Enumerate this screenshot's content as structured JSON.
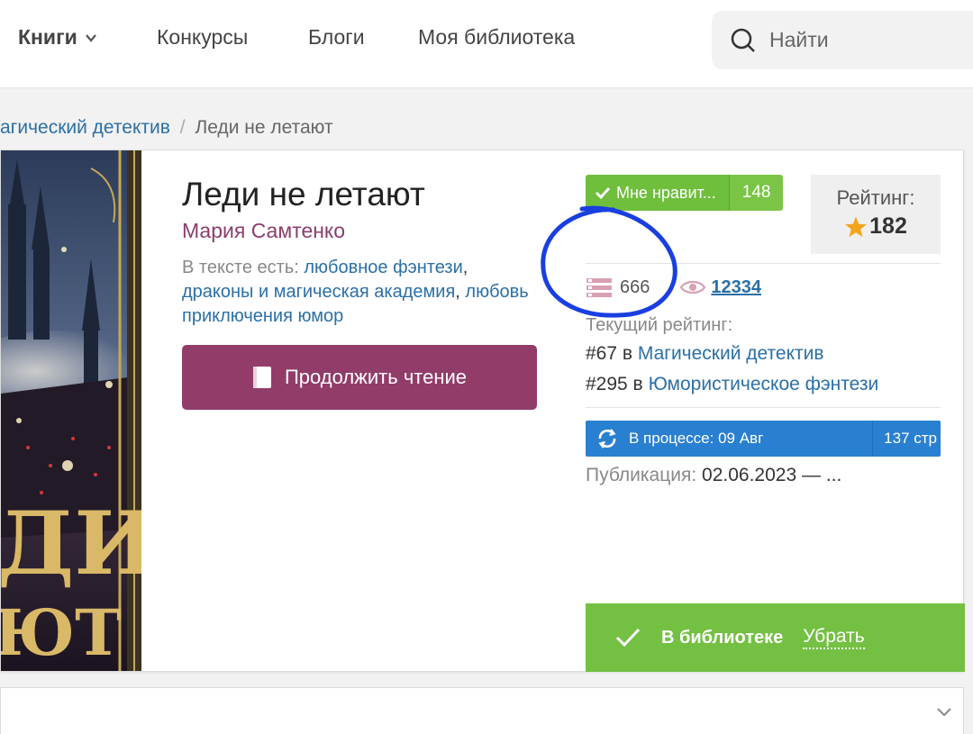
{
  "nav": {
    "items": [
      {
        "label": "Книги",
        "has_dropdown": true
      },
      {
        "label": "Конкурсы"
      },
      {
        "label": "Блоги"
      },
      {
        "label": "Моя библиотека"
      }
    ],
    "search": {
      "placeholder": "Найти"
    }
  },
  "breadcrumb": {
    "parent": "агический детектив",
    "separator": "/",
    "current": "Леди не летают"
  },
  "book": {
    "title": "Леди не летают",
    "author": "Мария Самтенко",
    "tags_label": "В тексте есть:",
    "tags": [
      "любовное фэнтези",
      "драконы и магическая академия",
      "любовь приключения юмор"
    ],
    "read_button": "Продолжить чтение"
  },
  "stats": {
    "like_label": "Мне нравит...",
    "like_count": "148",
    "rating_label": "Рейтинг:",
    "rating_value": "182",
    "library_count": "666",
    "views": "12334",
    "current_rating_label": "Текущий рейтинг:",
    "rank1_prefix": "#67 в",
    "rank1_genre": "Магический детектив",
    "rank2_prefix": "#295 в",
    "rank2_genre": "Юмористическое фэнтези",
    "status": "В процессе: 09 Авг",
    "pages": "137 стр",
    "publication_label": "Публикация:",
    "publication_date": "02.06.2023 — ...",
    "library_label": "В библиотеке",
    "remove_label": "Убрать"
  },
  "cover": {
    "visible_text_line1": "ДИ",
    "visible_text_line2": "ЮТ"
  },
  "colors": {
    "accent_purple": "#923c69",
    "link_blue": "#2b6fa6",
    "like_green": "#6fbe3c",
    "status_blue": "#2a80d0",
    "library_green": "#74c043",
    "annotation_blue": "#1a3fe0"
  }
}
